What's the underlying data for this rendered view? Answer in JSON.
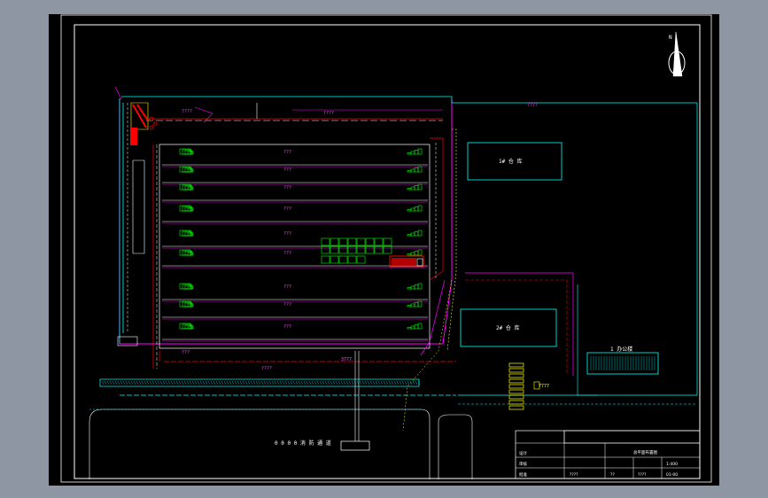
{
  "labels": {
    "warehouse_1": "1# 仓 库",
    "warehouse_2": "2# 仓 库",
    "office": "1 办公楼",
    "road": "0 0 0 0 消 防 通 道",
    "tank_label": "???",
    "row_label": "???",
    "misc_q": "????",
    "dim_label": "7777",
    "mid_label": "3777",
    "north": "N"
  },
  "title_block": {
    "drawing_title": "总平面布置图",
    "r1c1": "设计",
    "r2c1": "审核",
    "r3c1": "批准",
    "scale": "1:400",
    "date": "??",
    "sheet": "????",
    "code": "????",
    "num": "01-00"
  },
  "colors": {
    "cyan": "#00ffff",
    "white": "#ffffff",
    "green": "#00ff00",
    "magenta": "#ff00ff",
    "red": "#ff0000",
    "yellow": "#ffff00"
  }
}
